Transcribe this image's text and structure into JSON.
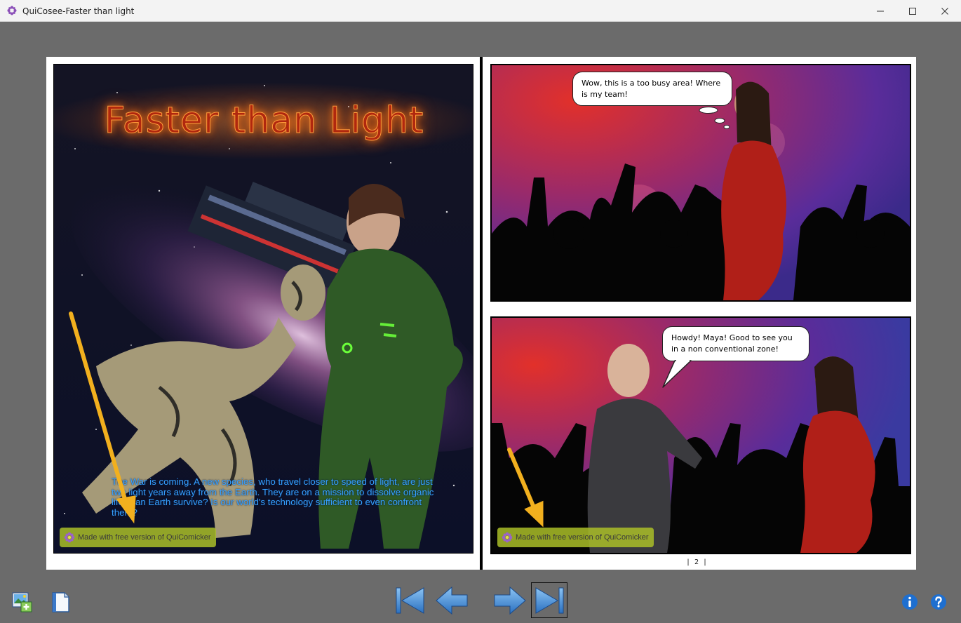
{
  "window": {
    "title": "QuiCosee-Faster than light",
    "minimize_icon": "minimize-icon",
    "maximize_icon": "maximize-icon",
    "close_icon": "close-icon"
  },
  "cover": {
    "title": "Faster than Light",
    "blurb": "The War is coming. A new species, who travel closer to speed of light, are just two light years away from the Earth. They are on a mission to dissolve organic life. Can Earth survive? Is our world's technology sufficient to even confront them?"
  },
  "page2": {
    "panel1_bubble": "Wow, this is a too busy area! Where is my team!",
    "panel2_bubble": "Howdy! Maya! Good to see you in a non conventional zone!",
    "page_number": "| 2 |"
  },
  "watermark": {
    "text": "Made with free version of QuiComicker"
  },
  "toolbar": {
    "left_icons": [
      "image-import-icon",
      "page-icon"
    ],
    "nav_icons": [
      "first-page-icon",
      "previous-page-icon",
      "next-page-icon",
      "last-page-icon"
    ],
    "right_icons": [
      "info-icon",
      "help-icon"
    ]
  },
  "colors": {
    "background": "#6b6b6b",
    "nav_blue": "#4a90d8",
    "watermark": "#aabe28",
    "arrow": "#f2b01e"
  }
}
